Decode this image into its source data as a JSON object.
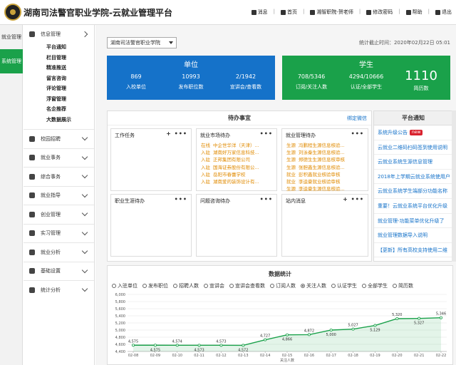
{
  "header": {
    "title": "湖南司法警官职业学院-云就业管理平台",
    "nav": [
      {
        "label": "消息",
        "icon": "envelope-icon"
      },
      {
        "label": "首页",
        "icon": "home-icon"
      },
      {
        "label": "湘智职院-贺老师",
        "icon": "user-icon"
      },
      {
        "label": "修改密码",
        "icon": "lock-icon"
      },
      {
        "label": "帮助",
        "icon": "help-icon"
      },
      {
        "label": "退出",
        "icon": "logout-icon"
      }
    ]
  },
  "rail": [
    {
      "label": "就业管理",
      "active": false
    },
    {
      "label": "系统管理",
      "active": true
    }
  ],
  "sidebar": {
    "open_group": "信息管理",
    "sub_items": [
      "平台通知",
      "栏目管理",
      "精准推送",
      "留言咨询",
      "评论管理",
      "浮窗管理",
      "名企推荐",
      "大数据展示"
    ],
    "groups": [
      "校园招聘",
      "就业事务",
      "综合事务",
      "就业指导",
      "创业管理",
      "实习管理",
      "就业分析",
      "基础设置",
      "统计分析"
    ]
  },
  "main": {
    "school_select": "湖南司法警官职业学院",
    "stat_time": "统计截止时间：2020年02月22日 05:01",
    "unit_card": {
      "title": "单位",
      "metrics": [
        {
          "value": "869",
          "label": "入校单位"
        },
        {
          "value": "10993",
          "label": "发布职位数"
        },
        {
          "value": "2/1942",
          "label": "宣讲会/查看数"
        }
      ]
    },
    "student_card": {
      "title": "学生",
      "metrics": [
        {
          "value": "708/5346",
          "label": "订阅/关注人数"
        },
        {
          "value": "4294/10666",
          "label": "认证/全部学生"
        },
        {
          "value": "1110",
          "label": "简历数"
        }
      ]
    },
    "todo": {
      "title": "待办事宜",
      "bind_wechat": "绑定微信",
      "boxes": [
        {
          "title": "工作任务",
          "lines": []
        },
        {
          "title": "就业市场待办",
          "lines": [
            {
              "tag": "在线",
              "text": "中企世华洋（天津）..."
            },
            {
              "tag": "入驻",
              "text": "湖南好万家信息科技..."
            },
            {
              "tag": "入驻",
              "text": "正邦集团有限公司"
            },
            {
              "tag": "入驻",
              "text": "国海证券股份有限公..."
            },
            {
              "tag": "入驻",
              "text": "岳阳市春蕾学校"
            },
            {
              "tag": "入驻",
              "text": "湖南爱的装饰设计有..."
            }
          ]
        },
        {
          "title": "就业管理待办",
          "lines": [
            {
              "tag": "生源",
              "text": "冯鹏程生源信息核验..."
            },
            {
              "tag": "生源",
              "text": "刘泳秦生源信息核验..."
            },
            {
              "tag": "生源",
              "text": "郑德生生源信息核审核"
            },
            {
              "tag": "生源",
              "text": "张胆鑫生源信息核验..."
            },
            {
              "tag": "就业",
              "text": "彭积鑫就业核验审核"
            },
            {
              "tag": "就业",
              "text": "李逵豪就业核验审核"
            },
            {
              "tag": "生源",
              "text": "李逵豪生源信息核验..."
            }
          ]
        },
        {
          "title": "职业生涯待办",
          "lines": []
        },
        {
          "title": "问题咨询待办",
          "lines": []
        },
        {
          "title": "站内消息",
          "lines": []
        }
      ]
    },
    "notice": {
      "title": "平台通知",
      "new_label": "new",
      "items": [
        "系统升级公告",
        "云就业二维码扫码签到使用说明",
        "云就业系统生源信息管理",
        "2018年上学期云就业系统使用户",
        "云就业系统学生端部分功能名称",
        "重要！云就业系统平台优化升级",
        "就业管理-功能菜单优化升级了",
        "就业管理数据导入说明",
        "【更新】所有高校支持使用二维"
      ]
    },
    "stats": {
      "title": "数据统计",
      "options": [
        "入驻单位",
        "发布职位",
        "招聘人数",
        "宣讲会",
        "宣讲会查看数",
        "订阅人数",
        "关注人数",
        "认证学生",
        "全部学生",
        "简历数"
      ],
      "selected": "关注人数"
    }
  },
  "chart_data": {
    "type": "area",
    "categories": [
      "02-08",
      "02-09",
      "02-10",
      "02-11",
      "02-12",
      "02-13",
      "02-14",
      "02-15",
      "02-16",
      "02-17",
      "02-18",
      "02-19",
      "02-20",
      "02-21",
      "02-22"
    ],
    "values": [
      4575,
      4575,
      4574,
      4573,
      4573,
      4572,
      4727,
      4866,
      4872,
      5000,
      5027,
      5129,
      5320,
      5327,
      5346
    ],
    "xlabel": "关注人数",
    "ylim": [
      4400,
      6000
    ],
    "yticks": [
      4400,
      4600,
      4800,
      5000,
      5200,
      5400,
      5600,
      5800,
      6000
    ],
    "color": "#1aa14a",
    "grid": true
  }
}
